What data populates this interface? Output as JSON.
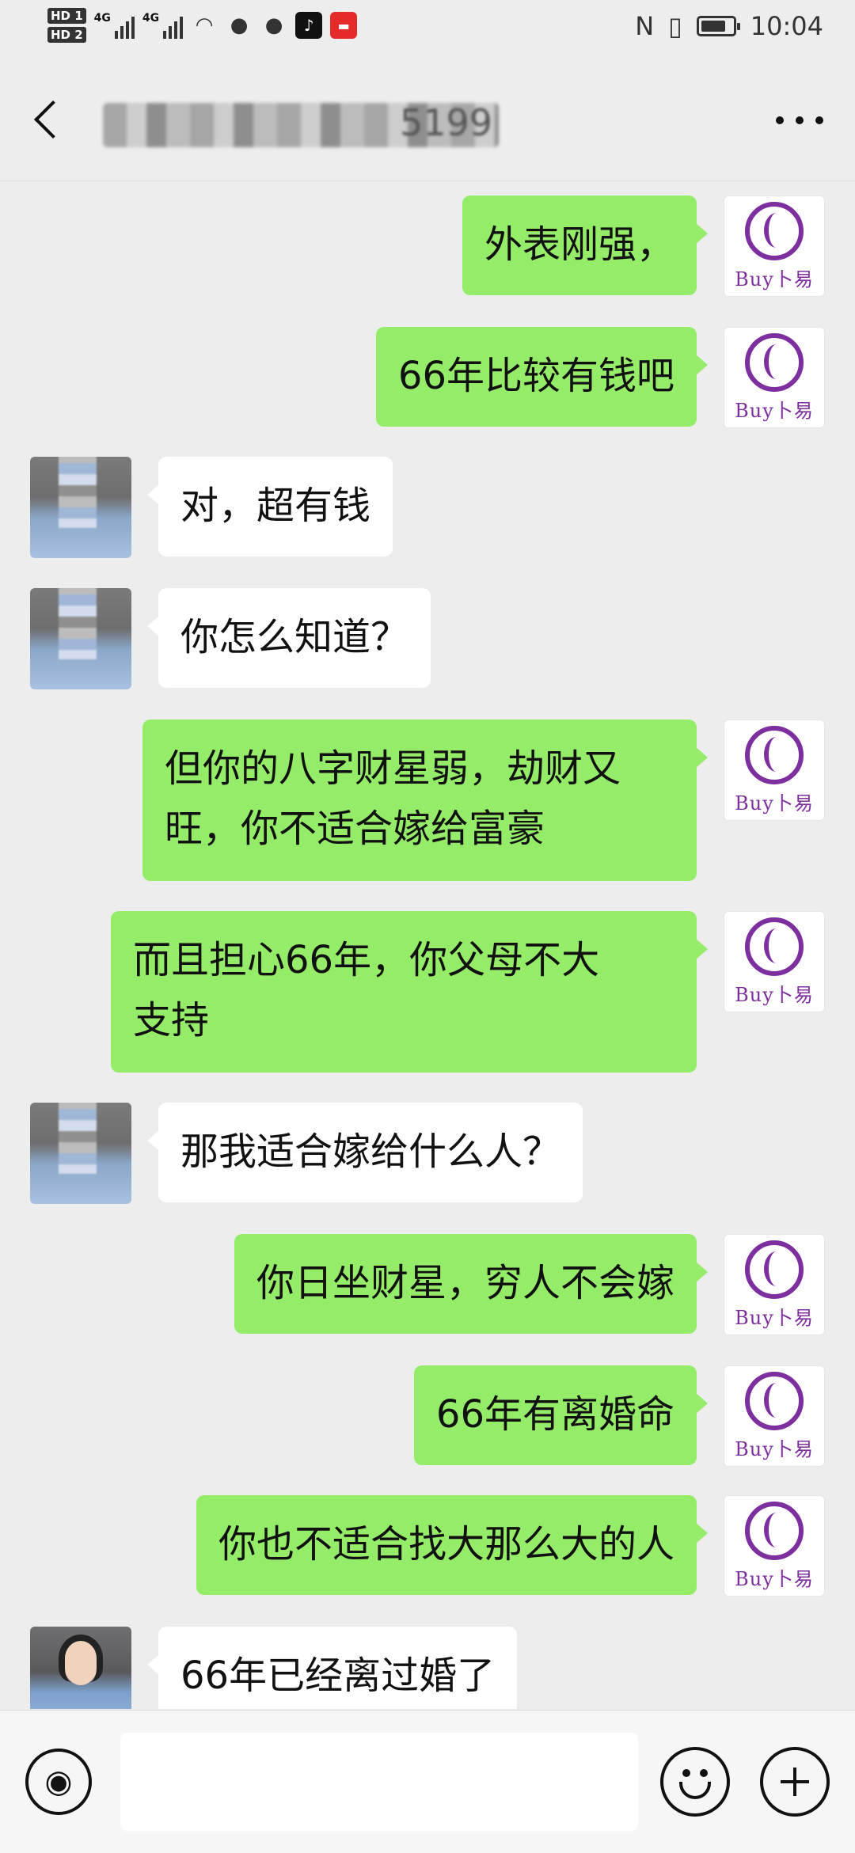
{
  "status_bar": {
    "hd1": "HD 1",
    "hd2": "HD 2",
    "net1": "4G",
    "net2": "4G",
    "time": "10:04"
  },
  "header": {
    "title_visible_fragment": "5199"
  },
  "brand_avatar": {
    "label": "Buy卜易",
    "color": "#7d2f9f"
  },
  "messages": [
    {
      "side": "right",
      "text": "外表刚强，"
    },
    {
      "side": "right",
      "text": "66年比较有钱吧"
    },
    {
      "side": "left",
      "text": "对，超有钱"
    },
    {
      "side": "left",
      "text": "你怎么知道？"
    },
    {
      "side": "right",
      "text": "但你的八字财星弱，劫财又\n旺，你不适合嫁给富豪"
    },
    {
      "side": "right",
      "text": "而且担心66年，你父母不大\n支持"
    },
    {
      "side": "left",
      "text": "那我适合嫁给什么人？"
    },
    {
      "side": "right",
      "text": "你日坐财星，穷人不会嫁"
    },
    {
      "side": "right",
      "text": "66年有离婚命"
    },
    {
      "side": "right",
      "text": "你也不适合找大那么大的人"
    },
    {
      "side": "left",
      "text": "66年已经离过婚了"
    }
  ],
  "colors": {
    "background": "#ededed",
    "outgoing_bubble": "#95ec69",
    "incoming_bubble": "#ffffff"
  },
  "icons": {
    "back": "back-arrow-icon",
    "more": "more-dots-icon",
    "voice": "voice-icon",
    "emoji": "emoji-icon",
    "plus": "plus-icon"
  }
}
